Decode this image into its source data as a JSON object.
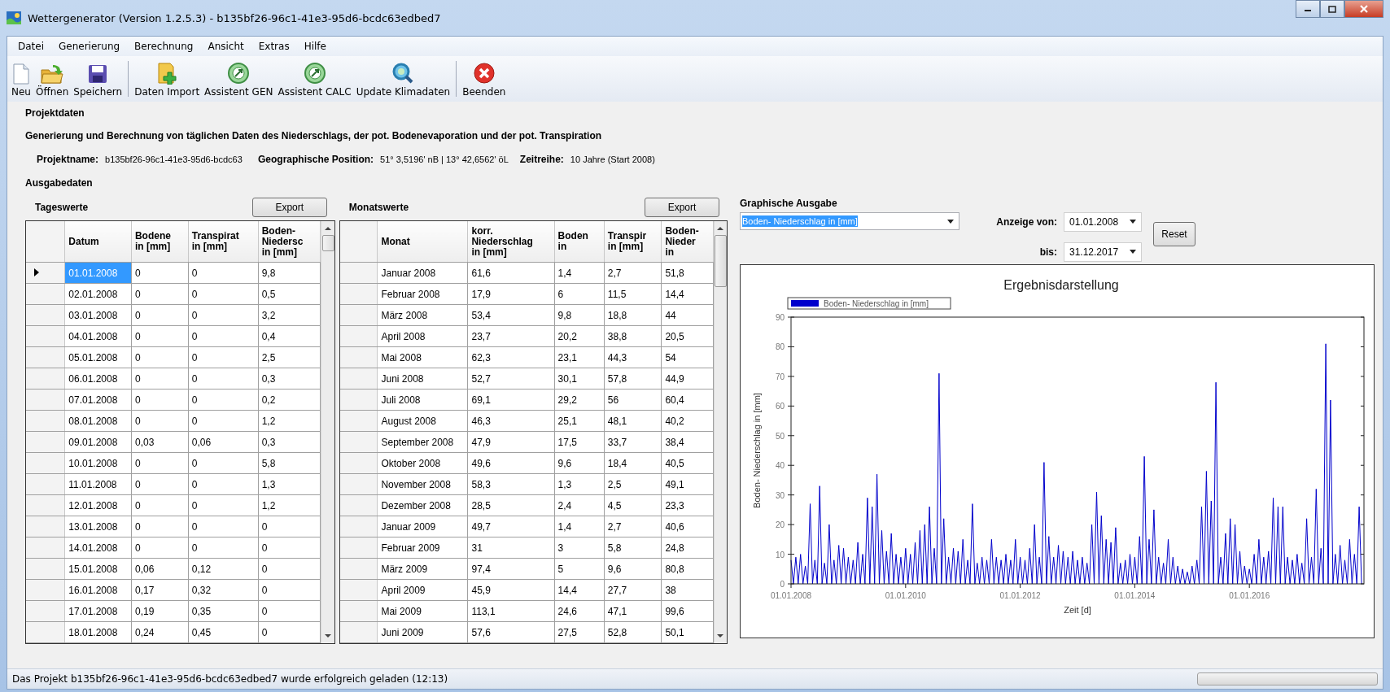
{
  "window": {
    "title": "Wettergenerator (Version 1.2.5.3) - b135bf26-96c1-41e3-95d6-bcdc63edbed7"
  },
  "menu": [
    "Datei",
    "Generierung",
    "Berechnung",
    "Ansicht",
    "Extras",
    "Hilfe"
  ],
  "toolbar": [
    [
      {
        "label": "Neu",
        "kind": "new"
      },
      {
        "label": "Öffnen",
        "kind": "open"
      },
      {
        "label": "Speichern",
        "kind": "save"
      }
    ],
    [
      {
        "label": "Daten Import",
        "kind": "import"
      },
      {
        "label": "Assistent GEN",
        "kind": "wizard"
      },
      {
        "label": "Assistent CALC",
        "kind": "wizard"
      },
      {
        "label": "Update Klimadaten",
        "kind": "search"
      }
    ],
    [
      {
        "label": "Beenden",
        "kind": "exit"
      }
    ]
  ],
  "project": {
    "heading": "Projektdaten",
    "description": "Generierung und Berechnung von täglichen Daten des Niederschlags, der pot. Bodenevaporation und der pot. Transpiration",
    "fields": [
      {
        "label": "Projektname:",
        "value": "b135bf26-96c1-41e3-95d6-bcdc63"
      },
      {
        "label": "Geographische Position:",
        "value": "51° 3,5196' nB  |  13° 42,6562' öL"
      },
      {
        "label": "Zeitreihe:",
        "value": "10 Jahre (Start 2008)"
      }
    ]
  },
  "output": {
    "heading": "Ausgabedaten",
    "daily": {
      "title": "Tageswerte",
      "export": "Export",
      "columns": [
        "Datum",
        "Bodene\nin [mm]",
        "Transpirat\nin [mm]",
        "Boden-\nNiedersc\nin [mm]"
      ],
      "rows": [
        {
          "selected": true,
          "cells": [
            "01.01.2008",
            "0",
            "0",
            "9,8"
          ]
        },
        {
          "selected": false,
          "cells": [
            "02.01.2008",
            "0",
            "0",
            "0,5"
          ]
        },
        {
          "selected": false,
          "cells": [
            "03.01.2008",
            "0",
            "0",
            "3,2"
          ]
        },
        {
          "selected": false,
          "cells": [
            "04.01.2008",
            "0",
            "0",
            "0,4"
          ]
        },
        {
          "selected": false,
          "cells": [
            "05.01.2008",
            "0",
            "0",
            "2,5"
          ]
        },
        {
          "selected": false,
          "cells": [
            "06.01.2008",
            "0",
            "0",
            "0,3"
          ]
        },
        {
          "selected": false,
          "cells": [
            "07.01.2008",
            "0",
            "0",
            "0,2"
          ]
        },
        {
          "selected": false,
          "cells": [
            "08.01.2008",
            "0",
            "0",
            "1,2"
          ]
        },
        {
          "selected": false,
          "cells": [
            "09.01.2008",
            "0,03",
            "0,06",
            "0,3"
          ]
        },
        {
          "selected": false,
          "cells": [
            "10.01.2008",
            "0",
            "0",
            "5,8"
          ]
        },
        {
          "selected": false,
          "cells": [
            "11.01.2008",
            "0",
            "0",
            "1,3"
          ]
        },
        {
          "selected": false,
          "cells": [
            "12.01.2008",
            "0",
            "0",
            "1,2"
          ]
        },
        {
          "selected": false,
          "cells": [
            "13.01.2008",
            "0",
            "0",
            "0"
          ]
        },
        {
          "selected": false,
          "cells": [
            "14.01.2008",
            "0",
            "0",
            "0"
          ]
        },
        {
          "selected": false,
          "cells": [
            "15.01.2008",
            "0,06",
            "0,12",
            "0"
          ]
        },
        {
          "selected": false,
          "cells": [
            "16.01.2008",
            "0,17",
            "0,32",
            "0"
          ]
        },
        {
          "selected": false,
          "cells": [
            "17.01.2008",
            "0,19",
            "0,35",
            "0"
          ]
        },
        {
          "selected": false,
          "cells": [
            "18.01.2008",
            "0,24",
            "0,45",
            "0"
          ]
        }
      ]
    },
    "monthly": {
      "title": "Monatswerte",
      "export": "Export",
      "columns": [
        "Monat",
        "korr.\nNiederschlag\nin [mm]",
        "Boden\nin",
        "Transpir\nin [mm]",
        "Boden-\nNieder\nin"
      ],
      "rows": [
        [
          "Januar 2008",
          "61,6",
          "1,4",
          "2,7",
          "51,8"
        ],
        [
          "Februar 2008",
          "17,9",
          "6",
          "11,5",
          "14,4"
        ],
        [
          "März 2008",
          "53,4",
          "9,8",
          "18,8",
          "44"
        ],
        [
          "April 2008",
          "23,7",
          "20,2",
          "38,8",
          "20,5"
        ],
        [
          "Mai 2008",
          "62,3",
          "23,1",
          "44,3",
          "54"
        ],
        [
          "Juni 2008",
          "52,7",
          "30,1",
          "57,8",
          "44,9"
        ],
        [
          "Juli 2008",
          "69,1",
          "29,2",
          "56",
          "60,4"
        ],
        [
          "August 2008",
          "46,3",
          "25,1",
          "48,1",
          "40,2"
        ],
        [
          "September 2008",
          "47,9",
          "17,5",
          "33,7",
          "38,4"
        ],
        [
          "Oktober 2008",
          "49,6",
          "9,6",
          "18,4",
          "40,5"
        ],
        [
          "November 2008",
          "58,3",
          "1,3",
          "2,5",
          "49,1"
        ],
        [
          "Dezember 2008",
          "28,5",
          "2,4",
          "4,5",
          "23,3"
        ],
        [
          "Januar 2009",
          "49,7",
          "1,4",
          "2,7",
          "40,6"
        ],
        [
          "Februar 2009",
          "31",
          "3",
          "5,8",
          "24,8"
        ],
        [
          "März 2009",
          "97,4",
          "5",
          "9,6",
          "80,8"
        ],
        [
          "April 2009",
          "45,9",
          "14,4",
          "27,7",
          "38"
        ],
        [
          "Mai 2009",
          "113,1",
          "24,6",
          "47,1",
          "99,6"
        ],
        [
          "Juni 2009",
          "57,6",
          "27,5",
          "52,8",
          "50,1"
        ]
      ]
    },
    "graph": {
      "title": "Graphische Ausgabe",
      "series_choice": "Boden- Niederschlag in [mm]",
      "from_label": "Anzeige von:",
      "from": "01.01.2008",
      "to_label": "bis:",
      "to": "31.12.2017",
      "reset": "Reset",
      "chart_data": {
        "type": "line",
        "categories": [
          "01.01.2008",
          null,
          null,
          null,
          null,
          null,
          null,
          null,
          null,
          null,
          null,
          null,
          null,
          null,
          null,
          null,
          null,
          null,
          null,
          null,
          null,
          null,
          null,
          null,
          null,
          null,
          null,
          null,
          null,
          null,
          null,
          null,
          null,
          null,
          null,
          null,
          null,
          null,
          null,
          null,
          null,
          null,
          null,
          null,
          null,
          null,
          null,
          null,
          "01.01.2010",
          null,
          null,
          null,
          null,
          null,
          null,
          null,
          null,
          null,
          null,
          null,
          null,
          null,
          null,
          null,
          null,
          null,
          null,
          null,
          null,
          null,
          null,
          null,
          null,
          null,
          null,
          null,
          null,
          null,
          null,
          null,
          null,
          null,
          null,
          null,
          null,
          null,
          null,
          null,
          null,
          null,
          null,
          null,
          null,
          null,
          null,
          null,
          "01.01.2012",
          null,
          null,
          null,
          null,
          null,
          null,
          null,
          null,
          null,
          null,
          null,
          null,
          null,
          null,
          null,
          null,
          null,
          null,
          null,
          null,
          null,
          null,
          null,
          null,
          null,
          null,
          null,
          null,
          null,
          null,
          null,
          null,
          null,
          null,
          null,
          null,
          null,
          null,
          null,
          null,
          null,
          null,
          null,
          null,
          null,
          null,
          null,
          "01.01.2014",
          null,
          null,
          null,
          null,
          null,
          null,
          null,
          null,
          null,
          null,
          null,
          null,
          null,
          null,
          null,
          null,
          null,
          null,
          null,
          null,
          null,
          null,
          null,
          null,
          null,
          null,
          null,
          null,
          null,
          null,
          null,
          null,
          null,
          null,
          null,
          null,
          null,
          null,
          null,
          null,
          null,
          null,
          null,
          null,
          null,
          null,
          null,
          "01.01.2016",
          null,
          null,
          null,
          null,
          null,
          null,
          null,
          null,
          null,
          null,
          null,
          null,
          null,
          null,
          null,
          null,
          null,
          null,
          null,
          null,
          null,
          null,
          null,
          null,
          null,
          null,
          null,
          null,
          null,
          null,
          null,
          null,
          null,
          null,
          null,
          null,
          null,
          null,
          null,
          null,
          null,
          null,
          null,
          null,
          null,
          null,
          null
        ],
        "title": "Ergebnisdarstellung",
        "xlabel": "Zeit [d]",
        "ylabel": "Boden- Niederschlag in [mm]",
        "series": [
          {
            "name": "Boden- Niederschlag in [mm]",
            "color": "#0000cc",
            "values": [
              8,
              0,
              9,
              0,
              10,
              0,
              6,
              0,
              27,
              0,
              8,
              0,
              33,
              0,
              7,
              0,
              20,
              0,
              8,
              0,
              13,
              0,
              12,
              0,
              9,
              0,
              8,
              0,
              14,
              0,
              10,
              0,
              29,
              0,
              26,
              0,
              37,
              0,
              18,
              0,
              11,
              0,
              17,
              0,
              10,
              0,
              9,
              0,
              12,
              0,
              10,
              0,
              14,
              0,
              18,
              0,
              20,
              0,
              26,
              0,
              12,
              0,
              71,
              0,
              22,
              0,
              9,
              0,
              12,
              0,
              11,
              0,
              15,
              0,
              8,
              0,
              27,
              0,
              7,
              0,
              9,
              0,
              8,
              0,
              15,
              0,
              9,
              0,
              8,
              0,
              10,
              0,
              8,
              0,
              15,
              0,
              9,
              0,
              8,
              0,
              12,
              0,
              20,
              0,
              9,
              0,
              41,
              0,
              16,
              0,
              9,
              0,
              13,
              0,
              11,
              0,
              9,
              0,
              11,
              0,
              8,
              0,
              9,
              0,
              7,
              0,
              20,
              0,
              31,
              0,
              23,
              0,
              15,
              0,
              14,
              0,
              19,
              0,
              7,
              0,
              8,
              0,
              10,
              0,
              9,
              0,
              16,
              0,
              43,
              0,
              15,
              0,
              25,
              0,
              9,
              0,
              7,
              0,
              15,
              0,
              9,
              0,
              6,
              0,
              5,
              0,
              4,
              0,
              6,
              0,
              8,
              0,
              26,
              0,
              38,
              0,
              28,
              0,
              68,
              0,
              9,
              0,
              17,
              0,
              22,
              0,
              20,
              0,
              11,
              0,
              6,
              0,
              5,
              0,
              10,
              0,
              15,
              0,
              9,
              0,
              11,
              0,
              29,
              0,
              26,
              0,
              26,
              0,
              9,
              0,
              8,
              0,
              10,
              0,
              7,
              0,
              22,
              0,
              9,
              0,
              32,
              0,
              12,
              0,
              81,
              0,
              62,
              0,
              10,
              0,
              13,
              0,
              8,
              0,
              15,
              0,
              10,
              0,
              26,
              0
            ]
          }
        ],
        "ylim": [
          0,
          90
        ],
        "yticks": [
          0,
          10,
          20,
          30,
          40,
          50,
          60,
          70,
          80,
          90
        ]
      }
    }
  },
  "status_bar": {
    "text": "Das Projekt b135bf26-96c1-41e3-95d6-bcdc63edbed7 wurde erfolgreich geladen (12:13)",
    "progress": {
      "level": 0
    }
  }
}
